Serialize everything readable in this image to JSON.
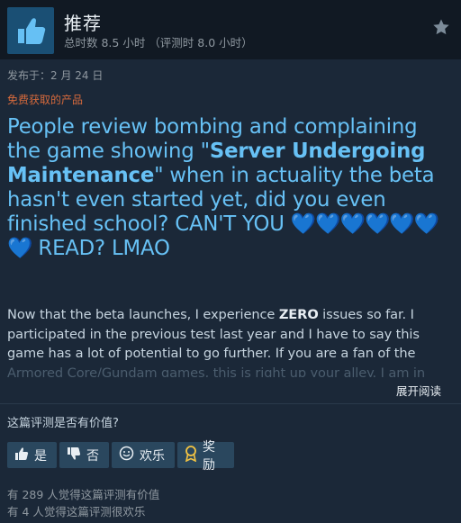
{
  "header": {
    "recommendation": "推荐",
    "hours_label": "总时数 8.5 小时 （评测时 8.0 小时）"
  },
  "meta": {
    "posted": "发布于：2 月 24 日",
    "product_received": "免费获取的产品"
  },
  "review": {
    "big_part1": "People review bombing and complaining the game showing \"",
    "big_bold": "Server Undergoing Maintenance",
    "big_part2": "\" when in actuality the beta hasn't even started yet, did you even finished school? CAN'T YOU ",
    "hearts": "💙💙💙💙💙💙💙",
    "big_part3": " READ? LMAO",
    "body_part1": "Now that the beta launches, I experience ",
    "body_bold": "ZERO",
    "body_part2": " issues so far. I participated in the previous test last year and I have to say this game has a lot of potential to go further. If you are a fan of the ",
    "body_faded": "Armored Core/Gundam games, this is right up your alley. I am in"
  },
  "expand_label": "展开阅读",
  "helpful": {
    "question": "这篇评测是否有价值?",
    "yes": "是",
    "no": "否",
    "funny": "欢乐",
    "award": "奖励"
  },
  "stats": {
    "helpful_count": "有 289 人觉得这篇评测有价值",
    "funny_count": "有 4 人觉得这篇评测很欢乐"
  },
  "colors": {
    "background": "#1b2838",
    "header_bg": "#111923",
    "accent_blue": "#67c1f5",
    "free_orange": "#d76a3c",
    "button_bg": "#2a475e"
  }
}
